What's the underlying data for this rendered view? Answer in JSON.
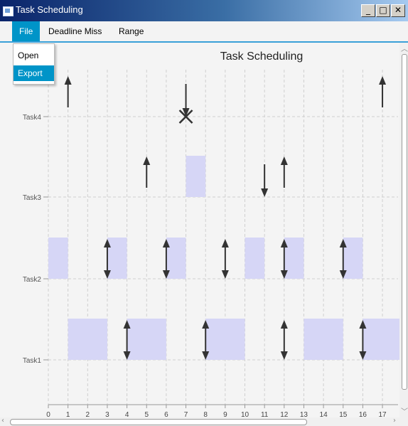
{
  "window": {
    "title": "Task Scheduling"
  },
  "menubar": {
    "items": [
      "File",
      "Deadline Miss",
      "Range"
    ]
  },
  "file_menu": {
    "items": [
      "Open",
      "Export"
    ],
    "selected": "Export"
  },
  "chart_data": {
    "type": "gantt",
    "title": "Task Scheduling",
    "categories": [
      "Task1",
      "Task2",
      "Task3",
      "Task4"
    ],
    "x_ticks": [
      0,
      1,
      2,
      3,
      4,
      5,
      6,
      7,
      8,
      9,
      10,
      11,
      12,
      13,
      14,
      15,
      16,
      17
    ],
    "grid": true,
    "colors": {
      "bar": "#d6d6f6",
      "arrow": "#333333",
      "grid": "#cfcfcf"
    },
    "bars": [
      {
        "task": "Task1",
        "start": 1,
        "end": 3
      },
      {
        "task": "Task1",
        "start": 4,
        "end": 6
      },
      {
        "task": "Task1",
        "start": 8,
        "end": 10
      },
      {
        "task": "Task1",
        "start": 13,
        "end": 15
      },
      {
        "task": "Task1",
        "start": 16,
        "end": 18
      },
      {
        "task": "Task2",
        "start": 0,
        "end": 1
      },
      {
        "task": "Task2",
        "start": 3,
        "end": 4
      },
      {
        "task": "Task2",
        "start": 6,
        "end": 7
      },
      {
        "task": "Task2",
        "start": 10,
        "end": 11
      },
      {
        "task": "Task2",
        "start": 12,
        "end": 13
      },
      {
        "task": "Task2",
        "start": 15,
        "end": 16
      },
      {
        "task": "Task3",
        "start": 7,
        "end": 8
      }
    ],
    "events": [
      {
        "task": "Task1",
        "time": 4,
        "kind": "release-deadline"
      },
      {
        "task": "Task1",
        "time": 8,
        "kind": "release-deadline"
      },
      {
        "task": "Task1",
        "time": 12,
        "kind": "release-deadline"
      },
      {
        "task": "Task1",
        "time": 16,
        "kind": "release-deadline"
      },
      {
        "task": "Task2",
        "time": 3,
        "kind": "release-deadline"
      },
      {
        "task": "Task2",
        "time": 6,
        "kind": "release-deadline"
      },
      {
        "task": "Task2",
        "time": 9,
        "kind": "release-deadline"
      },
      {
        "task": "Task2",
        "time": 12,
        "kind": "release-deadline"
      },
      {
        "task": "Task2",
        "time": 15,
        "kind": "release-deadline"
      },
      {
        "task": "Task3",
        "time": 5,
        "kind": "release"
      },
      {
        "task": "Task3",
        "time": 11,
        "kind": "deadline"
      },
      {
        "task": "Task3",
        "time": 12,
        "kind": "release"
      },
      {
        "task": "Task4",
        "time": 1,
        "kind": "release"
      },
      {
        "task": "Task4",
        "time": 7,
        "kind": "deadline-miss"
      },
      {
        "task": "Task4",
        "time": 17,
        "kind": "release"
      }
    ]
  }
}
